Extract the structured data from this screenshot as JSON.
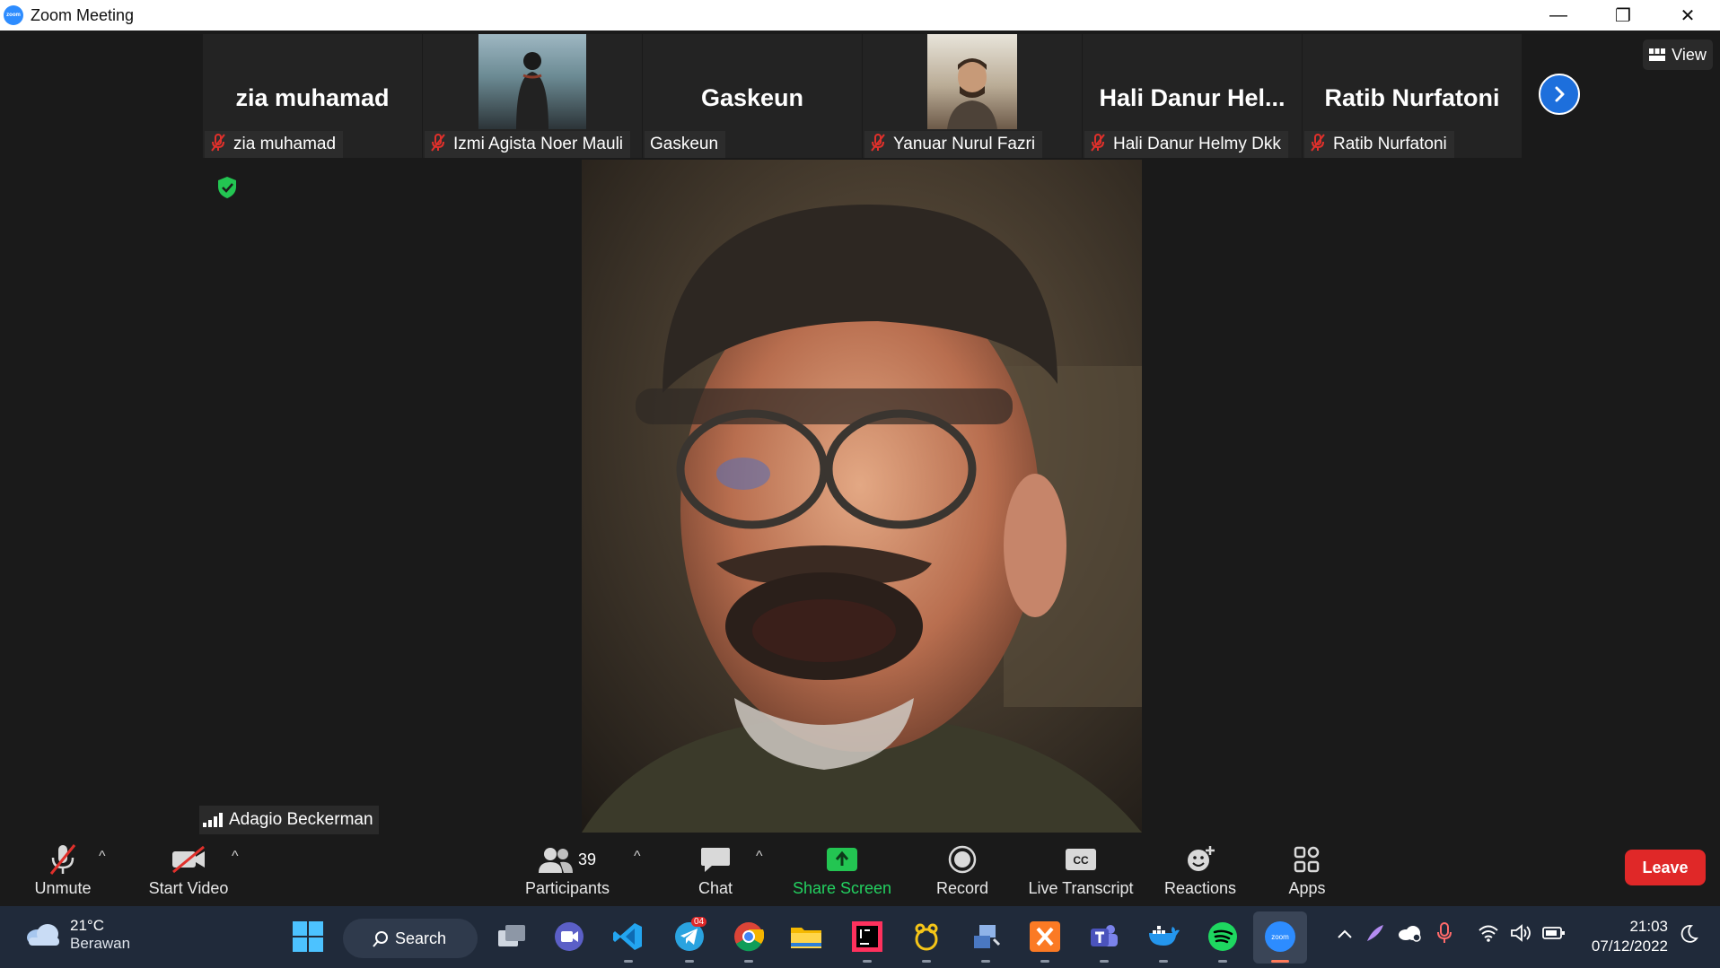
{
  "window": {
    "title": "Zoom Meeting",
    "logo_text": "zoom",
    "minimize": "—",
    "restore": "❐",
    "close": "✕"
  },
  "view_button": {
    "label": "View"
  },
  "thumbnails": [
    {
      "big_name": "zia muhamad",
      "name": "zia muhamad",
      "muted": true,
      "video": false
    },
    {
      "big_name": "",
      "name": "Izmi Agista Noer Mauli",
      "muted": true,
      "video": true
    },
    {
      "big_name": "Gaskeun",
      "name": "Gaskeun",
      "muted": false,
      "video": false
    },
    {
      "big_name": "",
      "name": "Yanuar Nurul Fazri",
      "muted": true,
      "video": true
    },
    {
      "big_name": "Hali  Danur  Hel...",
      "name": "Hali Danur Helmy Dkk",
      "muted": true,
      "video": false
    },
    {
      "big_name": "Ratib Nurfatoni",
      "name": "Ratib Nurfatoni",
      "muted": true,
      "video": false
    }
  ],
  "active_speaker": {
    "name": "Adagio Beckerman"
  },
  "toolbar": {
    "unmute": "Unmute",
    "start_video": "Start Video",
    "participants": "Participants",
    "participants_count": "39",
    "chat": "Chat",
    "share_screen": "Share Screen",
    "record": "Record",
    "live_transcript": "Live Transcript",
    "reactions": "Reactions",
    "apps": "Apps",
    "leave": "Leave",
    "caret": "^",
    "cc": "CC"
  },
  "taskbar": {
    "weather_temp": "21°C",
    "weather_desc": "Berawan",
    "search": "Search",
    "telegram_badge": "04",
    "zoom_label": "zoom",
    "time": "21:03",
    "date": "07/12/2022"
  },
  "colors": {
    "accent_blue": "#2d8cff",
    "leave_red": "#e02828",
    "share_green": "#23d160",
    "muted_red": "#e0302b",
    "shield_green": "#23c552"
  }
}
